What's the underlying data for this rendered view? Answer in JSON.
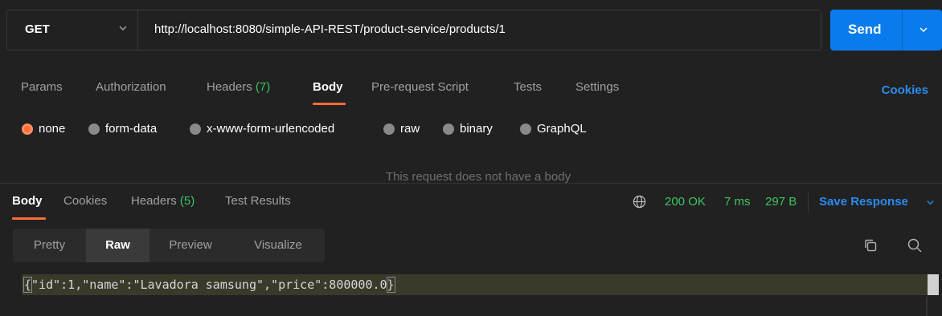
{
  "request": {
    "method": "GET",
    "url": "http://localhost:8080/simple-API-REST/product-service/products/1",
    "send_label": "Send"
  },
  "request_tabs": [
    {
      "label": "Params"
    },
    {
      "label": "Authorization"
    },
    {
      "label": "Headers",
      "count": "(7)"
    },
    {
      "label": "Body"
    },
    {
      "label": "Pre-request Script"
    },
    {
      "label": "Tests"
    },
    {
      "label": "Settings"
    }
  ],
  "cookies_label": "Cookies",
  "body_types": [
    {
      "label": "none"
    },
    {
      "label": "form-data"
    },
    {
      "label": "x-www-form-urlencoded"
    },
    {
      "label": "raw"
    },
    {
      "label": "binary"
    },
    {
      "label": "GraphQL"
    }
  ],
  "no_body_message": "This request does not have a body",
  "response_tabs": [
    {
      "label": "Body"
    },
    {
      "label": "Cookies"
    },
    {
      "label": "Headers",
      "count": "(5)"
    },
    {
      "label": "Test Results"
    }
  ],
  "response_meta": {
    "status": "200 OK",
    "time": "7 ms",
    "size": "297 B",
    "save_label": "Save Response"
  },
  "view_tabs": [
    {
      "label": "Pretty"
    },
    {
      "label": "Raw"
    },
    {
      "label": "Preview"
    },
    {
      "label": "Visualize"
    }
  ],
  "response_body": {
    "open_brace": "{",
    "inner": "\"id\":1,\"name\":\"Lavadora samsung\",\"price\":800000.0",
    "close_brace": "}"
  },
  "colors": {
    "accent_orange": "#ff6c37",
    "send_blue": "#097bed",
    "link_blue": "#2b8cf0",
    "success_green": "#3dc55f"
  },
  "icons": {
    "method_caret": "chevron-down-icon",
    "send_caret": "chevron-down-icon",
    "network": "globe-icon",
    "save_caret": "chevron-down-icon",
    "copy": "copy-icon",
    "search": "search-icon"
  }
}
